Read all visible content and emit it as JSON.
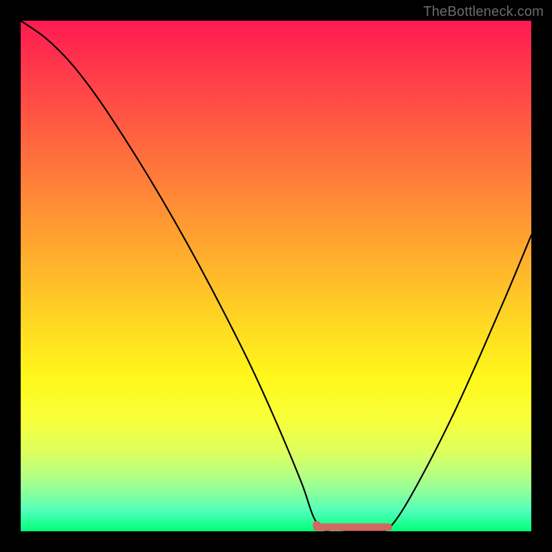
{
  "attribution": "TheBottleneck.com",
  "chart_data": {
    "type": "line",
    "title": "",
    "xlabel": "",
    "ylabel": "",
    "xlim": [
      0,
      1
    ],
    "ylim": [
      0,
      1
    ],
    "series": [
      {
        "name": "curve",
        "x": [
          0.0,
          0.05,
          0.1,
          0.15,
          0.2,
          0.25,
          0.3,
          0.35,
          0.4,
          0.45,
          0.5,
          0.55,
          0.575,
          0.6,
          0.65,
          0.7,
          0.72,
          0.75,
          0.8,
          0.85,
          0.9,
          0.95,
          1.0
        ],
        "values": [
          1.0,
          0.965,
          0.915,
          0.85,
          0.775,
          0.695,
          0.61,
          0.52,
          0.425,
          0.325,
          0.215,
          0.095,
          0.025,
          0.0,
          0.0,
          0.0,
          0.005,
          0.045,
          0.135,
          0.235,
          0.345,
          0.46,
          0.58
        ]
      }
    ],
    "annotations": [
      {
        "name": "flat-region",
        "x_start": 0.58,
        "x_end": 0.72,
        "y": 0.0
      }
    ],
    "background": {
      "type": "vertical-gradient",
      "stops": [
        {
          "pos": 0.0,
          "color": "#ff1a52"
        },
        {
          "pos": 0.5,
          "color": "#ffba2a"
        },
        {
          "pos": 0.78,
          "color": "#f8ff3a"
        },
        {
          "pos": 1.0,
          "color": "#00ff7a"
        }
      ]
    }
  }
}
